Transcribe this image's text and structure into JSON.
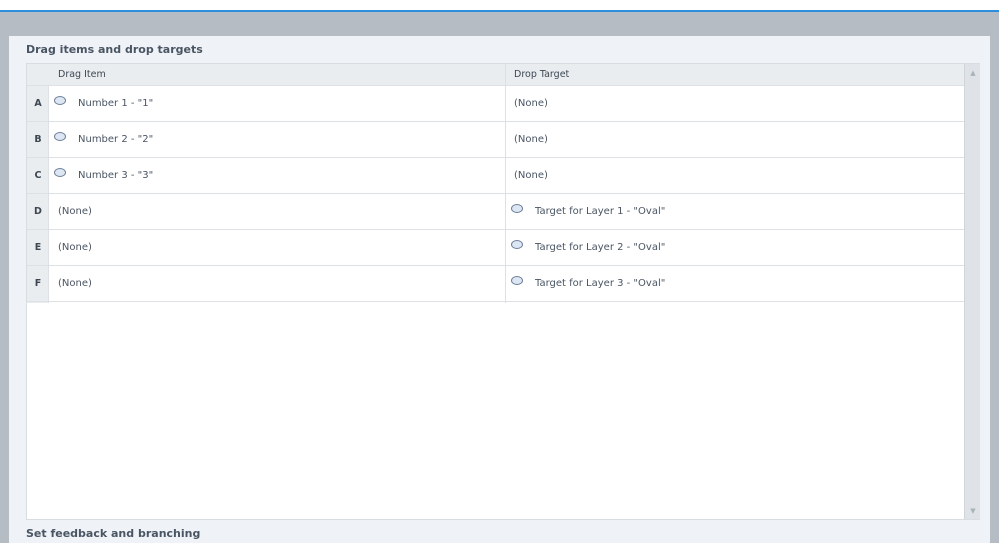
{
  "section_title": "Drag items and drop targets",
  "footer_title": "Set feedback and branching",
  "columns": {
    "drag": "Drag Item",
    "drop": "Drop Target"
  },
  "rows": [
    {
      "label": "A",
      "drag": "Number 1 - \"1\"",
      "drag_icon": true,
      "drop": "(None)",
      "drop_icon": false
    },
    {
      "label": "B",
      "drag": "Number 2 - \"2\"",
      "drag_icon": true,
      "drop": "(None)",
      "drop_icon": false
    },
    {
      "label": "C",
      "drag": "Number 3 - \"3\"",
      "drag_icon": true,
      "drop": "(None)",
      "drop_icon": false
    },
    {
      "label": "D",
      "drag": "(None)",
      "drag_icon": false,
      "drop": "Target for Layer 1 - \"Oval\"",
      "drop_icon": true
    },
    {
      "label": "E",
      "drag": "(None)",
      "drag_icon": false,
      "drop": "Target for Layer 2 - \"Oval\"",
      "drop_icon": true
    },
    {
      "label": "F",
      "drag": "(None)",
      "drag_icon": false,
      "drop": "Target for Layer 3 - \"Oval\"",
      "drop_icon": true
    }
  ],
  "scroll": {
    "up": "▲",
    "down": "▼"
  }
}
